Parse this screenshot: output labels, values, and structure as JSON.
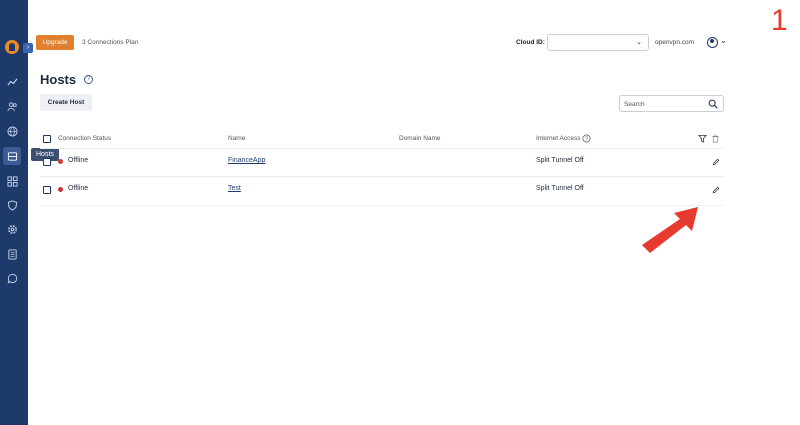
{
  "sidebar": {
    "tooltip": "Hosts"
  },
  "topbar": {
    "upgrade_label": "Upgrade",
    "plan_text": "3 Connections Plan",
    "cloud_id_label": "Cloud ID:",
    "cloud_id_value": "",
    "domain_text": "openvpn.com"
  },
  "page": {
    "title": "Hosts",
    "create_button": "Create Host",
    "search_placeholder": "Search"
  },
  "table": {
    "headers": [
      "Connection Status",
      "Name",
      "Domain Name",
      "Internet Access"
    ],
    "rows": [
      {
        "status": "Offline",
        "name": "FinanceApp",
        "domain": "",
        "internet_access": "Split Tunnel Off"
      },
      {
        "status": "Offline",
        "name": "Test",
        "domain": "",
        "internet_access": "Split Tunnel Off"
      }
    ]
  },
  "annotation": {
    "step_number": "1"
  },
  "colors": {
    "sidebar": "#1e3a6b",
    "accent": "#e07f2f",
    "offline_dot": "#c63a3a",
    "annotation": "#e53a2d"
  }
}
